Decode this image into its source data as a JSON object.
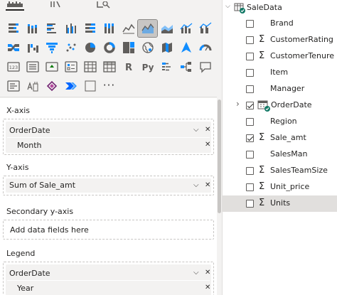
{
  "viz_tabs": [
    {
      "icon": "build-visual-icon",
      "active": true
    },
    {
      "icon": "format-visual-icon",
      "active": false
    },
    {
      "icon": "analytics-icon",
      "active": false
    }
  ],
  "viz_grid": [
    [
      "stacked-bar-icon",
      "stacked-column-icon",
      "clustered-bar-icon",
      "clustered-column-icon",
      "100-stacked-bar-icon",
      "100-stacked-column-icon",
      "line-chart-icon",
      "area-chart-icon",
      "stacked-area-icon",
      "line-stacked-column-icon",
      "line-clustered-column-icon"
    ],
    [
      "ribbon-chart-icon",
      "waterfall-chart-icon",
      "funnel-chart-icon",
      "scatter-chart-icon",
      "pie-chart-icon",
      "donut-chart-icon",
      "treemap-icon",
      "map-icon",
      "filled-map-icon",
      "azure-map-icon",
      "gauge-icon"
    ],
    [
      "card-icon",
      "multi-row-card-icon",
      "kpi-icon",
      "slicer-icon",
      "table-icon",
      "matrix-icon",
      "r-visual-icon",
      "python-visual-icon",
      "key-influencers-icon",
      "decomposition-tree-icon",
      "qa-icon"
    ],
    [
      "smart-narrative-icon",
      "paginated-report-icon",
      "power-apps-icon",
      "power-automate-icon",
      "custom-visual-icon",
      "more-visuals-icon"
    ]
  ],
  "selected_visual": "area-chart-icon",
  "wells": {
    "xaxis": {
      "title": "X-axis",
      "field": "OrderDate",
      "sub": "Month"
    },
    "yaxis": {
      "title": "Y-axis",
      "field": "Sum of Sale_amt"
    },
    "secondary": {
      "title": "Secondary y-axis",
      "placeholder": "Add data fields here"
    },
    "legend": {
      "title": "Legend",
      "field": "OrderDate",
      "sub": "Year"
    }
  },
  "fields": {
    "table_name": "SaleData",
    "items": [
      {
        "label": "Brand",
        "checked": false,
        "sigma": false
      },
      {
        "label": "CustomerRating",
        "checked": false,
        "sigma": true
      },
      {
        "label": "CustomerTenure",
        "checked": false,
        "sigma": true
      },
      {
        "label": "Item",
        "checked": false,
        "sigma": false
      },
      {
        "label": "Manager",
        "checked": false,
        "sigma": false
      },
      {
        "label": "OrderDate",
        "checked": true,
        "sigma": false,
        "hierarchy": true
      },
      {
        "label": "Region",
        "checked": false,
        "sigma": false
      },
      {
        "label": "Sale_amt",
        "checked": true,
        "sigma": true
      },
      {
        "label": "SalesMan",
        "checked": false,
        "sigma": false
      },
      {
        "label": "SalesTeamSize",
        "checked": false,
        "sigma": true
      },
      {
        "label": "Unit_price",
        "checked": false,
        "sigma": true
      },
      {
        "label": "Units",
        "checked": false,
        "sigma": true,
        "hover": true
      }
    ]
  },
  "colors": {
    "accent_teal": "#117865",
    "chart_blue": "#118dff",
    "icon_gray": "#605e5c"
  }
}
